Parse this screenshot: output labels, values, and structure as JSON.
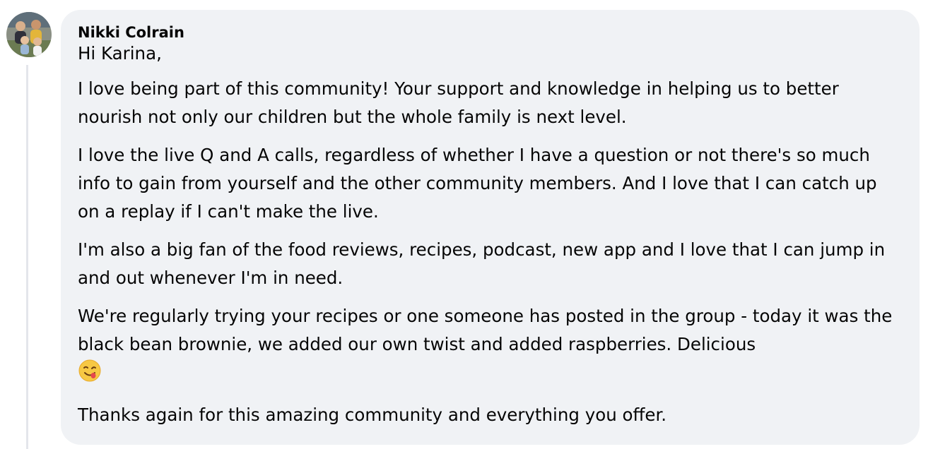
{
  "comment": {
    "author": "Nikki Colrain",
    "paragraphs": {
      "p0": "Hi Karina,",
      "p1": "I love being part of this community! Your support and knowledge in helping us to better nourish not only our children but the whole family is next level.",
      "p2": "I love the live Q and A calls, regardless of whether I have a question or not there's so much info to gain from yourself and the other community members. And I love that I can catch up on a replay if I can't make the live.",
      "p3": "I'm also a big fan of the food reviews, recipes, podcast, new app and I love that I can jump in and out whenever I'm in need.",
      "p4": "We're regularly trying your recipes or one someone has posted in the group - today it was the black bean brownie, we added our own twist and added raspberries. Delicious",
      "p5": "Thanks again for this amazing community and everything you offer."
    },
    "emoji": "face-savoring-food-emoji"
  },
  "colors": {
    "bubble_bg": "#f0f2f5",
    "text": "#050505",
    "thread_line": "#e4e6eb"
  }
}
